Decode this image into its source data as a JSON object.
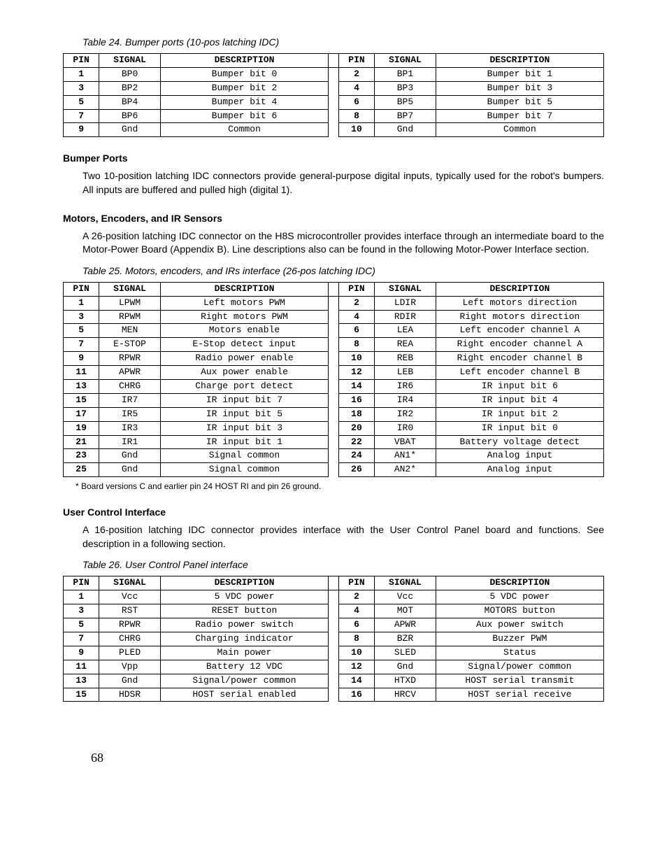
{
  "table24": {
    "caption": "Table 24. Bumper ports (10-pos latching IDC)",
    "headers": [
      "PIN",
      "SIGNAL",
      "DESCRIPTION",
      "PIN",
      "SIGNAL",
      "DESCRIPTION"
    ],
    "rows": [
      {
        "p1": "1",
        "s1": "BP0",
        "d1": "Bumper bit 0",
        "p2": "2",
        "s2": "BP1",
        "d2": "Bumper bit 1"
      },
      {
        "p1": "3",
        "s1": "BP2",
        "d1": "Bumper bit 2",
        "p2": "4",
        "s2": "BP3",
        "d2": "Bumper bit 3"
      },
      {
        "p1": "5",
        "s1": "BP4",
        "d1": "Bumper bit 4",
        "p2": "6",
        "s2": "BP5",
        "d2": "Bumper bit 5"
      },
      {
        "p1": "7",
        "s1": "BP6",
        "d1": "Bumper bit 6",
        "p2": "8",
        "s2": "BP7",
        "d2": "Bumper bit 7"
      },
      {
        "p1": "9",
        "s1": "Gnd",
        "d1": "Common",
        "p2": "10",
        "s2": "Gnd",
        "d2": "Common"
      }
    ]
  },
  "section1": {
    "heading": "Bumper Ports",
    "para": "Two 10-position latching IDC connectors provide general-purpose digital inputs, typically used for the robot's bumpers.  All inputs are buffered and pulled high (digital 1)."
  },
  "section2": {
    "heading": "Motors, Encoders, and IR Sensors",
    "para": "A 26-position latching IDC connector on the H8S microcontroller provides interface through an intermediate board to the Motor-Power Board (Appendix B).  Line descriptions also can be found in the following Motor-Power Interface section."
  },
  "table25": {
    "caption": "Table 25.  Motors, encoders, and IRs interface (26-pos latching IDC)",
    "headers": [
      "PIN",
      "SIGNAL",
      "DESCRIPTION",
      "PIN",
      "SIGNAL",
      "DESCRIPTION"
    ],
    "rows": [
      {
        "p1": "1",
        "s1": "LPWM",
        "d1": "Left motors PWM",
        "p2": "2",
        "s2": "LDIR",
        "d2": "Left motors direction"
      },
      {
        "p1": "3",
        "s1": "RPWM",
        "d1": "Right motors PWM",
        "p2": "4",
        "s2": "RDIR",
        "d2": "Right motors direction"
      },
      {
        "p1": "5",
        "s1": "MEN",
        "d1": "Motors enable",
        "p2": "6",
        "s2": "LEA",
        "d2": "Left encoder channel A"
      },
      {
        "p1": "7",
        "s1": "E-STOP",
        "d1": "E-Stop detect input",
        "p2": "8",
        "s2": "REA",
        "d2": "Right encoder channel A"
      },
      {
        "p1": "9",
        "s1": "RPWR",
        "d1": "Radio power enable",
        "p2": "10",
        "s2": "REB",
        "d2": "Right encoder channel B"
      },
      {
        "p1": "11",
        "s1": "APWR",
        "d1": "Aux power enable",
        "p2": "12",
        "s2": "LEB",
        "d2": "Left encoder channel B"
      },
      {
        "p1": "13",
        "s1": "CHRG",
        "d1": "Charge port detect",
        "p2": "14",
        "s2": "IR6",
        "d2": "IR input bit 6"
      },
      {
        "p1": "15",
        "s1": "IR7",
        "d1": "IR input bit 7",
        "p2": "16",
        "s2": "IR4",
        "d2": "IR input bit 4"
      },
      {
        "p1": "17",
        "s1": "IR5",
        "d1": "IR input bit 5",
        "p2": "18",
        "s2": "IR2",
        "d2": "IR input bit 2"
      },
      {
        "p1": "19",
        "s1": "IR3",
        "d1": "IR input bit 3",
        "p2": "20",
        "s2": "IR0",
        "d2": "IR input bit 0"
      },
      {
        "p1": "21",
        "s1": "IR1",
        "d1": "IR input bit 1",
        "p2": "22",
        "s2": "VBAT",
        "d2": "Battery voltage detect"
      },
      {
        "p1": "23",
        "s1": "Gnd",
        "d1": "Signal common",
        "p2": "24",
        "s2": "AN1*",
        "d2": "Analog input"
      },
      {
        "p1": "25",
        "s1": "Gnd",
        "d1": "Signal common",
        "p2": "26",
        "s2": "AN2*",
        "d2": "Analog input"
      }
    ],
    "footnote": "* Board versions C and earlier pin 24 HOST RI and pin 26 ground."
  },
  "section3": {
    "heading": "User Control Interface",
    "para": "A 16-position latching IDC connector provides interface with the User Control Panel board and functions.  See description in a following section."
  },
  "table26": {
    "caption": "Table 26. User Control Panel interface",
    "headers": [
      "PIN",
      "SIGNAL",
      "DESCRIPTION",
      "PIN",
      "SIGNAL",
      "DESCRIPTION"
    ],
    "rows": [
      {
        "p1": "1",
        "s1": "Vcc",
        "d1": "5 VDC power",
        "p2": "2",
        "s2": "Vcc",
        "d2": "5 VDC power"
      },
      {
        "p1": "3",
        "s1": "RST",
        "d1": "RESET button",
        "p2": "4",
        "s2": "MOT",
        "d2": "MOTORS button"
      },
      {
        "p1": "5",
        "s1": "RPWR",
        "d1": "Radio power switch",
        "p2": "6",
        "s2": "APWR",
        "d2": "Aux power switch"
      },
      {
        "p1": "7",
        "s1": "CHRG",
        "d1": "Charging indicator",
        "p2": "8",
        "s2": "BZR",
        "d2": "Buzzer PWM"
      },
      {
        "p1": "9",
        "s1": "PLED",
        "d1": "Main power",
        "p2": "10",
        "s2": "SLED",
        "d2": "Status"
      },
      {
        "p1": "11",
        "s1": "Vpp",
        "d1": "Battery 12 VDC",
        "p2": "12",
        "s2": "Gnd",
        "d2": "Signal/power common"
      },
      {
        "p1": "13",
        "s1": "Gnd",
        "d1": "Signal/power common",
        "p2": "14",
        "s2": "HTXD",
        "d2": "HOST serial transmit"
      },
      {
        "p1": "15",
        "s1": "HDSR",
        "d1": "HOST serial enabled",
        "p2": "16",
        "s2": "HRCV",
        "d2": "HOST serial receive"
      }
    ]
  },
  "pageNumber": "68"
}
